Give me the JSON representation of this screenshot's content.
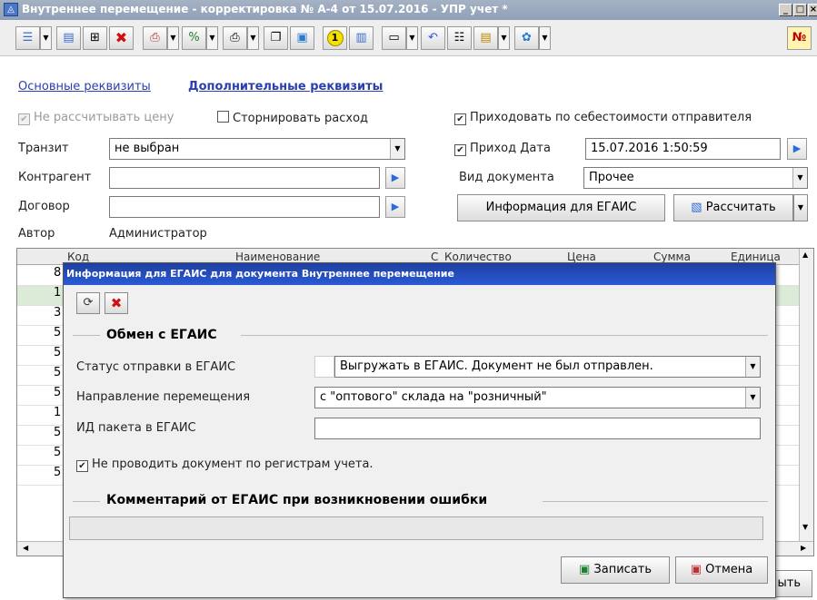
{
  "window": {
    "title": "Внутреннее перемещение - корректировка № А-4 от 15.07.2016 - УПР учет *"
  },
  "toolbar": {
    "badge": "№"
  },
  "tabs": [
    {
      "label": "Основные реквизиты"
    },
    {
      "label": "Дополнительные реквизиты"
    }
  ],
  "form": {
    "no_price_label": "Не рассчитывать цену",
    "storno_label": "Сторнировать расход",
    "cost_sender_label": "Приходовать по себестоимости отправителя",
    "transit_label": "Транзит",
    "transit_value": "не выбран",
    "income_date_label": "Приход Дата",
    "income_date_value": "15.07.2016 1:50:59",
    "contractor_label": "Контрагент",
    "contractor_value": "",
    "doc_type_label": "Вид документа",
    "doc_type_value": "Прочее",
    "contract_label": "Договор",
    "contract_value": "",
    "egais_info_btn": "Информация для ЕГАИС",
    "calculate_btn": "Рассчитать",
    "author_label": "Автор",
    "author_value": "Администратор"
  },
  "grid": {
    "columns": [
      "Код",
      "Наименование",
      "С",
      "Количество",
      "Цена",
      "Сумма",
      "Единица"
    ],
    "rows": [
      "8",
      "1",
      "3",
      "5",
      "5",
      "5",
      "5",
      "1",
      "5",
      "5",
      "5"
    ]
  },
  "dialog": {
    "title": "Информация для ЕГАИС для документа Внутреннее перемещение",
    "exchange_section": "Обмен с ЕГАИС",
    "status_label": "Статус отправки в ЕГАИС",
    "status_value": "Выгружать в ЕГАИС. Документ не был отправлен.",
    "direction_label": "Направление перемещения",
    "direction_value": "с \"оптового\" склада на \"розничный\"",
    "package_id_label": "ИД пакета в ЕГАИС",
    "package_id_value": "",
    "no_post_label": "Не проводить документ по регистрам учета.",
    "comment_section": "Комментарий от ЕГАИС при возникновении ошибки",
    "comment_value": "",
    "save_btn": "Записать",
    "cancel_btn": "Отмена"
  },
  "footer": {
    "close_btn_partial": "ыть"
  },
  "colors": {
    "link": "#2a3fb0",
    "dialog_title": "#1e3fa0",
    "delete_icon": "#d01010",
    "badge_red": "#c00000"
  }
}
